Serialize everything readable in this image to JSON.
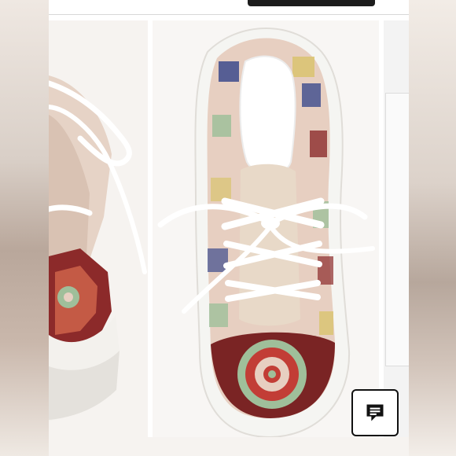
{
  "page": {
    "background": "#e9e3dd"
  },
  "header": {
    "action_button_color": "#1c1c1c"
  },
  "carousel": {
    "slides": [
      {
        "description_icon": "shoe-laces-closeup"
      },
      {
        "description_icon": "crochet-sneaker-top-view"
      },
      {
        "description_icon": "next-image-preview"
      }
    ]
  },
  "chat": {
    "icon": "chat-bubble-icon",
    "color": "#111111"
  },
  "colors": {
    "crochet_pink": "#e7cfc1",
    "crochet_red": "#8c2a2a",
    "crochet_blue": "#3c4a8c",
    "crochet_green": "#9fbf9a",
    "crochet_yellow": "#d9c36e",
    "sole_white": "#f5f5f2"
  }
}
